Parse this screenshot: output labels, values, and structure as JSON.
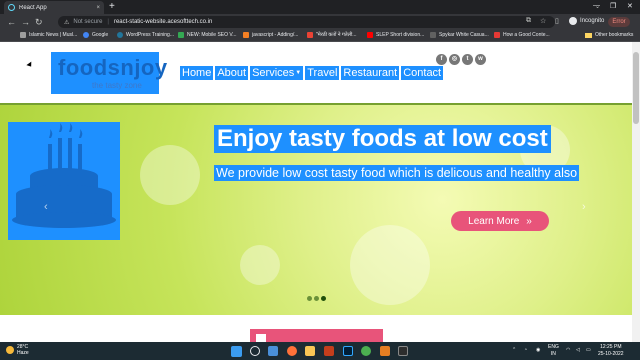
{
  "browser": {
    "tab_title": "React App",
    "tab_close": "×",
    "new_tab": "+",
    "tab_list": "⌄",
    "window_min": "—",
    "window_max": "❐",
    "window_close": "✕",
    "back": "←",
    "forward": "→",
    "reload": "↻",
    "security_icon": "warning-icon",
    "security_label": "Not secure",
    "separator": "|",
    "url": "react-static-website.acesofttech.co.in",
    "profile_label": "Incognito",
    "error_label": "Error",
    "bookmarks": [
      {
        "label": "Islamic News | Musl...",
        "color": "#9e9e9e"
      },
      {
        "label": "Google",
        "color": "#4285f4"
      },
      {
        "label": "WordPress Training...",
        "color": "#21759b"
      },
      {
        "label": "NEW: Mobile SEO V...",
        "color": "#34a853"
      },
      {
        "label": "javascript - Adding/...",
        "color": "#f48024"
      },
      {
        "label": "\"मेरठी कतों ने गतेली...",
        "color": "#ea4335"
      },
      {
        "label": "SLEP Short division...",
        "color": "#ff0000"
      },
      {
        "label": "Spykar White Casua...",
        "color": "#616161"
      },
      {
        "label": "How a Good Conte...",
        "color": "#e53935"
      }
    ],
    "other_bookmarks": "Other bookmarks"
  },
  "site": {
    "logo_text": "foodsnjoy",
    "logo_tagline": "the tasty zone",
    "nav": {
      "home": "Home",
      "about": "About",
      "services": "Services",
      "services_caret": "▼",
      "travel": "Travel",
      "restaurant": "Restaurant",
      "contact": "Contact"
    },
    "social": [
      {
        "icon": "facebook-icon",
        "glyph": "f"
      },
      {
        "icon": "instagram-icon",
        "glyph": "◎"
      },
      {
        "icon": "twitter-icon",
        "glyph": "t"
      },
      {
        "icon": "whatsapp-icon",
        "glyph": "w"
      }
    ],
    "hero": {
      "title": "Enjoy tasty foods at low cost",
      "subtitle": "We provide low cost tasty food which is delicous and healthy also",
      "button_label": "Learn More",
      "button_arrow": "»",
      "prev_arrow": "‹",
      "next_arrow": "›",
      "slide_count": 3,
      "active_slide": 3
    },
    "colors": {
      "highlight": "#1e90ff",
      "accent_pink": "#e8547a",
      "divider_green": "#76a030"
    }
  },
  "taskbar": {
    "temperature": "28°C",
    "weather_desc": "Haze",
    "lang_line1": "ENG",
    "lang_line2": "IN",
    "time": "12:25 PM",
    "date": "25-10-2022"
  }
}
